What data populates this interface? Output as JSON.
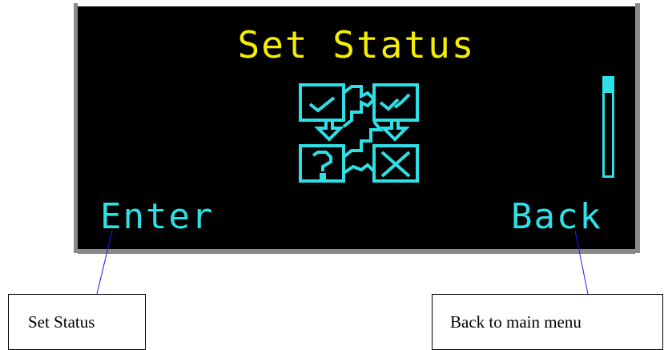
{
  "colors": {
    "title": "#f5ee00",
    "accent": "#2ee0e6",
    "screen_background": "#000000"
  },
  "screen": {
    "title": "Set Status",
    "graphic_icon": "status-grid-icon",
    "softkeys": {
      "left_label": "Enter",
      "right_label": "Back"
    },
    "scroll_position": 0.15
  },
  "callouts": {
    "left_text": "Set Status",
    "right_text": "Back to main menu"
  }
}
